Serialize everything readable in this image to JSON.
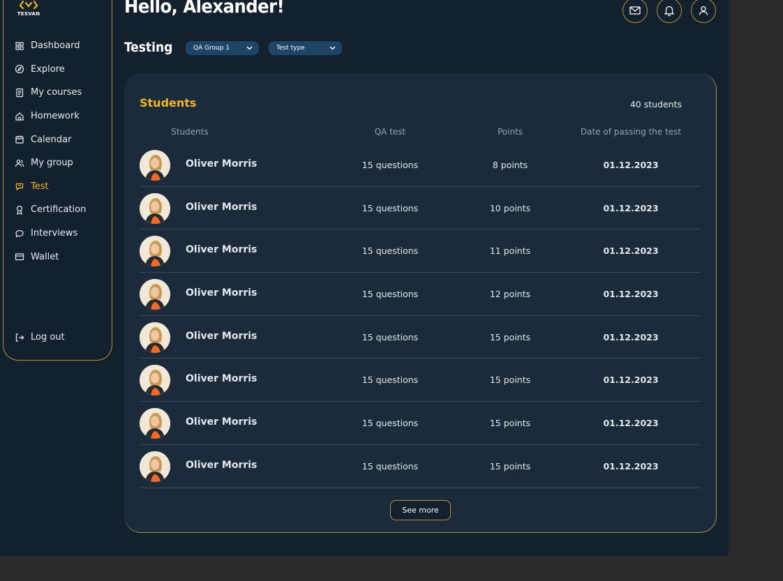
{
  "brand": {
    "logo_text": "TESVAN"
  },
  "header": {
    "greeting": "Hello, Alexander!"
  },
  "sidebar": {
    "items": [
      {
        "label": "Dashboard",
        "icon": "grid-icon",
        "active": false
      },
      {
        "label": "Explore",
        "icon": "compass-icon",
        "active": false
      },
      {
        "label": "My courses",
        "icon": "book-icon",
        "active": false
      },
      {
        "label": "Homework",
        "icon": "home-icon",
        "active": false
      },
      {
        "label": "Calendar",
        "icon": "calendar-icon",
        "active": false
      },
      {
        "label": "My group",
        "icon": "users-icon",
        "active": false
      },
      {
        "label": "Test",
        "icon": "test-icon",
        "active": true
      },
      {
        "label": "Certification",
        "icon": "award-icon",
        "active": false
      },
      {
        "label": "Interviews",
        "icon": "chat-icon",
        "active": false
      },
      {
        "label": "Wallet",
        "icon": "wallet-icon",
        "active": false
      }
    ],
    "logout_label": "Log out"
  },
  "testing": {
    "title": "Testing",
    "group_filter": "QA Group 1",
    "type_filter": "Test type"
  },
  "students": {
    "title": "Students",
    "count": "40 students",
    "columns": [
      "Students",
      "QA test",
      "Points",
      "Date of passing the test"
    ],
    "rows": [
      {
        "name": "Oliver Morris",
        "qa": "15 questions",
        "points": "8 points",
        "date": "01.12.2023"
      },
      {
        "name": "Oliver Morris",
        "qa": "15 questions",
        "points": "10 points",
        "date": "01.12.2023"
      },
      {
        "name": "Oliver Morris",
        "qa": "15 questions",
        "points": "11 points",
        "date": "01.12.2023"
      },
      {
        "name": "Oliver Morris",
        "qa": "15 questions",
        "points": "12 points",
        "date": "01.12.2023"
      },
      {
        "name": "Oliver Morris",
        "qa": "15 questions",
        "points": "15 points",
        "date": "01.12.2023"
      },
      {
        "name": "Oliver Morris",
        "qa": "15 questions",
        "points": "15 points",
        "date": "01.12.2023"
      },
      {
        "name": "Oliver Morris",
        "qa": "15 questions",
        "points": "15 points",
        "date": "01.12.2023"
      },
      {
        "name": "Oliver Morris",
        "qa": "15 questions",
        "points": "15 points",
        "date": "01.12.2023"
      }
    ],
    "see_more_label": "See more"
  },
  "colors": {
    "background": "#13212e",
    "card": "#1b2b3b",
    "accent": "#f5b626",
    "border_gold": "#b8913a",
    "dropdown": "#1f4566"
  }
}
